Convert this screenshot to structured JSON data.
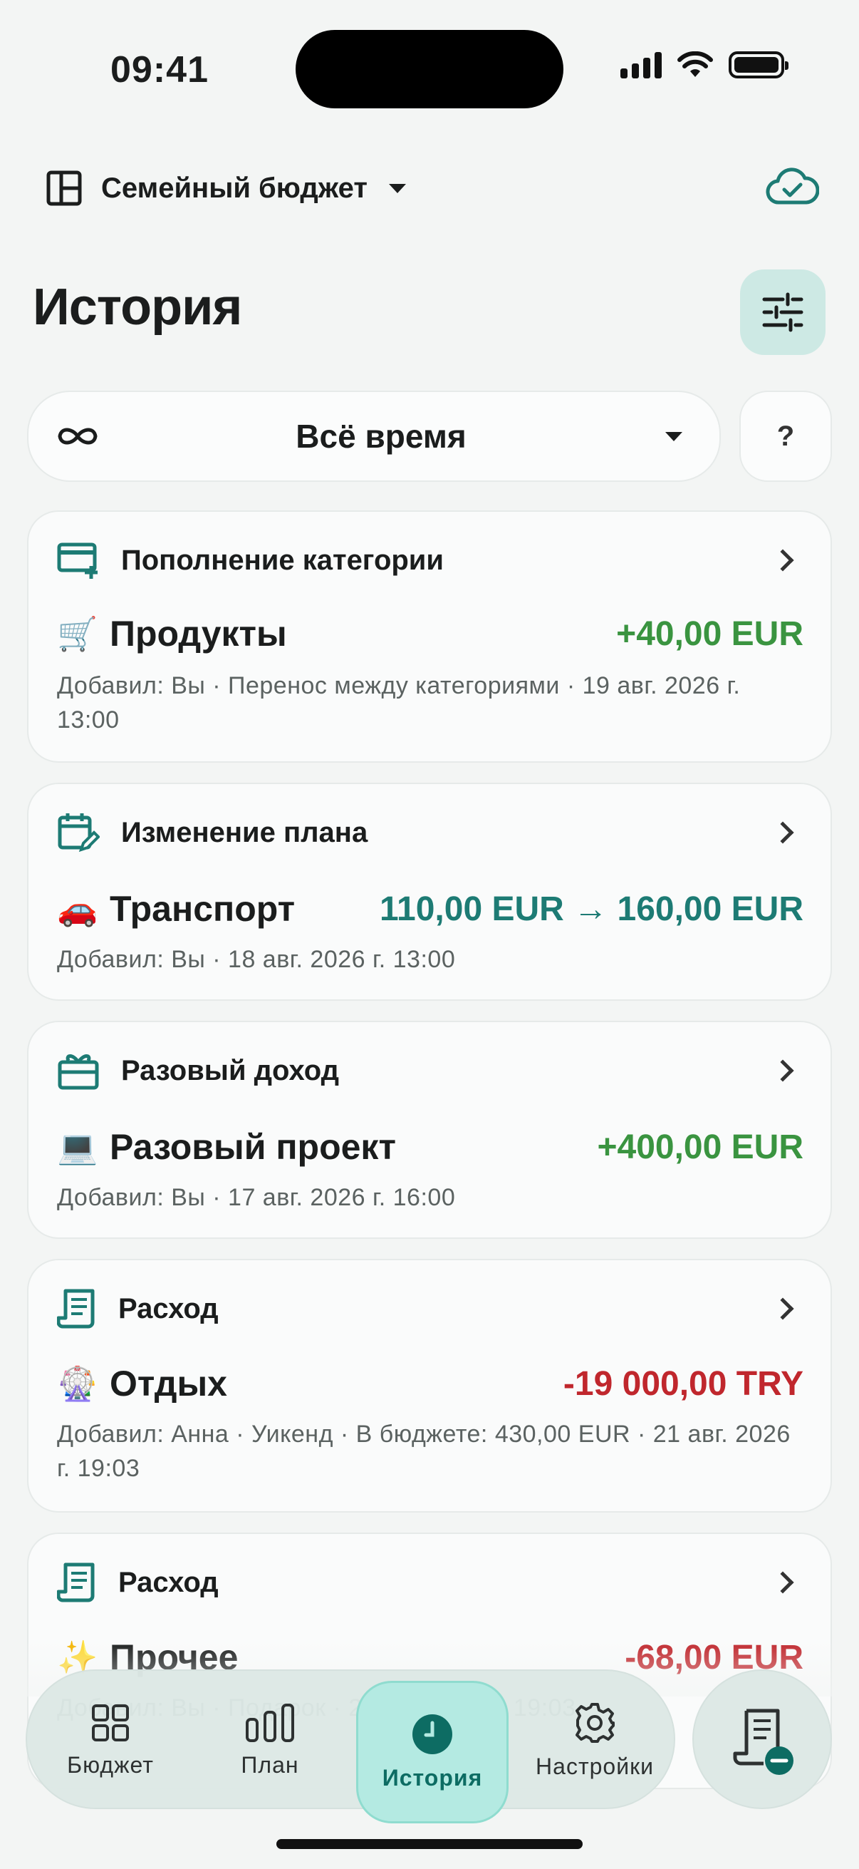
{
  "status_bar": {
    "time": "09:41"
  },
  "header": {
    "budget_name": "Семейный бюджет"
  },
  "page": {
    "title": "История"
  },
  "period": {
    "label": "Всё время",
    "help": "?"
  },
  "entries": [
    {
      "type": "Пополнение категории",
      "emoji": "🛒",
      "category": "Продукты",
      "amount": "+40,00 EUR",
      "meta": "Добавил: Вы · Перенос между категориями · 19 авг. 2026 г. 13:00"
    },
    {
      "type": "Изменение плана",
      "emoji": "🚗",
      "category": "Транспорт",
      "amount": "110,00 EUR → 160,00 EUR",
      "meta": "Добавил: Вы · 18 авг. 2026 г. 13:00"
    },
    {
      "type": "Разовый доход",
      "emoji": "💻",
      "category": "Разовый проект",
      "amount": "+400,00 EUR",
      "meta": "Добавил: Вы · 17 авг. 2026 г. 16:00"
    },
    {
      "type": "Расход",
      "emoji": "🎡",
      "category": "Отдых",
      "amount": "-19 000,00 TRY",
      "meta": "Добавил: Анна · Уикенд · В бюджете: 430,00 EUR · 21 авг. 2026 г. 19:03"
    },
    {
      "type": "Расход",
      "emoji": "✨",
      "category": "Прочее",
      "amount": "-68,00 EUR",
      "meta": "Добавил: Вы · Подарок · 20 авг. 2026 г. 19:03"
    }
  ],
  "nav": {
    "budget": "Бюджет",
    "plan": "План",
    "history": "История",
    "settings": "Настройки"
  },
  "colors": {
    "accent": "#1d7b74",
    "positive": "#3a9440",
    "negative": "#c0272d",
    "active_tab": "#b4eae2"
  }
}
